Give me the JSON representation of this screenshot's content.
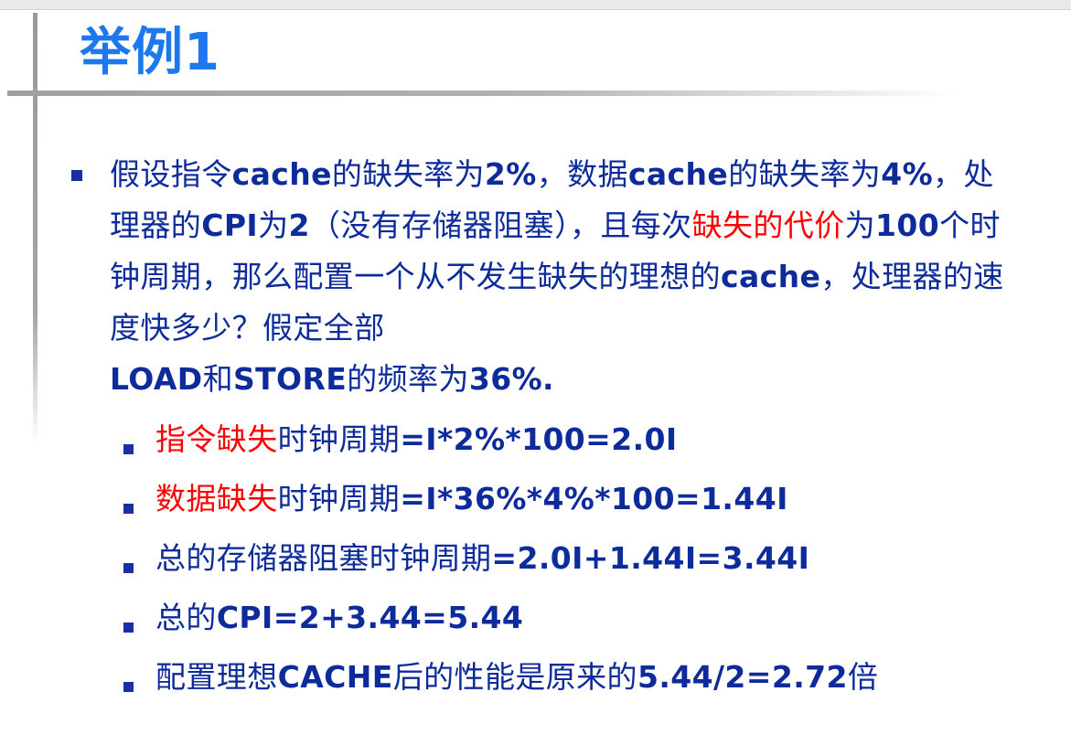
{
  "title": "举例1",
  "main": {
    "p1": "假设指令",
    "p2": "cache",
    "p3": "的缺失率为",
    "p4": "2%",
    "p5": "，数据",
    "p6": "cache",
    "p7": "的缺失率为",
    "p8": "4%",
    "p9": "，处理器的",
    "p10": "CPI",
    "p11": "为",
    "p12": "2",
    "p13": "（没有存储器阻塞），且每次",
    "p14": "缺失的代价",
    "p15": "为",
    "p16": "100",
    "p17": "个时钟周期，那么配置一个从不发生缺失的理想的",
    "p18": "cache",
    "p19": "，处理器的速度快多少？假定全部",
    "p20": "LOAD",
    "p21": "和",
    "p22": "STORE",
    "p23": "的频率为",
    "p24": "36%."
  },
  "sub_items": [
    {
      "red": "指令缺失",
      "text": "时钟周期",
      "value": "=I*2%*100=2.0I"
    },
    {
      "red": "数据缺失",
      "text": "时钟周期",
      "value": "=I*36%*4%*100=1.44I"
    },
    {
      "red": "",
      "text": "总的存储器阻塞时钟周期",
      "value": "=2.0I+1.44I=3.44I"
    },
    {
      "red": "",
      "text": "总的",
      "value": "CPI=2+3.44=5.44"
    },
    {
      "red": "",
      "text": "配置理想",
      "value": "CACHE",
      "text2": "后的性能是原来的",
      "value2": "5.44/2=2.72",
      "text3": "倍"
    }
  ]
}
